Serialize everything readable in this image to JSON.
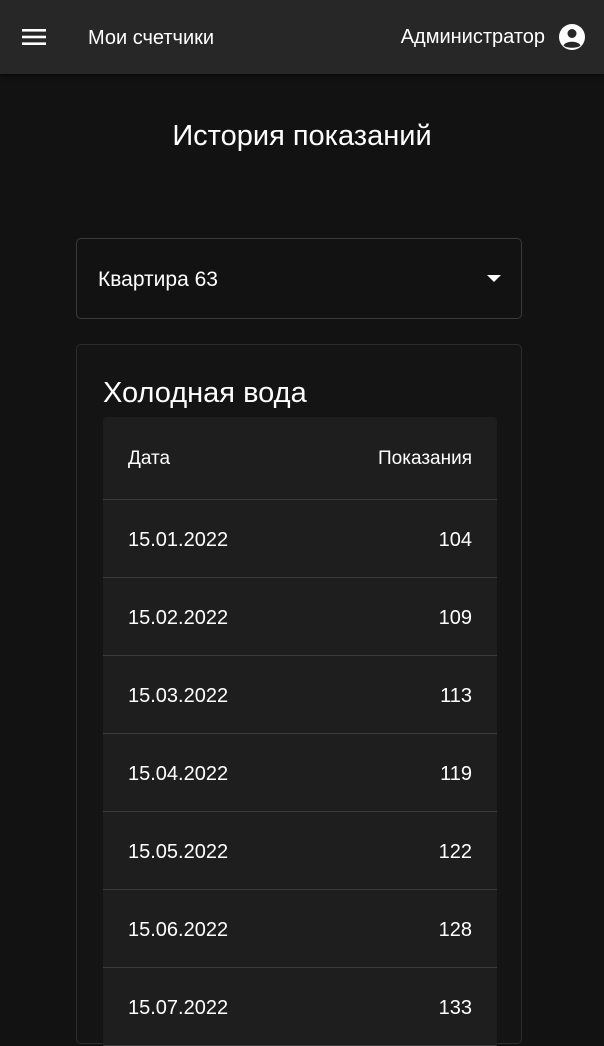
{
  "header": {
    "menu_icon": "hamburger-menu-icon",
    "title": "Мои счетчики",
    "user_name": "Администратор",
    "user_icon": "account-circle-icon"
  },
  "page": {
    "title": "История показаний"
  },
  "apartment_select": {
    "value": "Квартира 63",
    "arrow_icon": "caret-down-icon"
  },
  "meter_card": {
    "title": "Холодная вода",
    "columns": [
      "Дата",
      "Показания"
    ],
    "rows": [
      {
        "date": "15.01.2022",
        "value": "104"
      },
      {
        "date": "15.02.2022",
        "value": "109"
      },
      {
        "date": "15.03.2022",
        "value": "113"
      },
      {
        "date": "15.04.2022",
        "value": "119"
      },
      {
        "date": "15.05.2022",
        "value": "122"
      },
      {
        "date": "15.06.2022",
        "value": "128"
      },
      {
        "date": "15.07.2022",
        "value": "133"
      }
    ]
  },
  "colors": {
    "background": "#121212",
    "appbar": "#272727",
    "table_bg": "#1e1e1e",
    "text": "#ffffff"
  }
}
